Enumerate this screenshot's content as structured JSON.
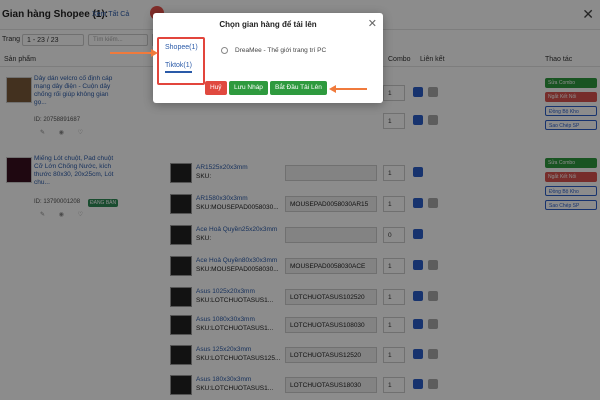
{
  "header": {
    "title": "Gian hàng Shopee (1):",
    "view_all": "Xem Tất Cả",
    "close": "✕"
  },
  "pager": {
    "label": "Trang",
    "range": "1 - 23 / 23",
    "search_placeholder": "Tìm kiếm..."
  },
  "table": {
    "headers": [
      "Sản phẩm",
      "Combo",
      "Liên kết",
      "Thao tác"
    ]
  },
  "products": [
    {
      "name": "Dây dán velcro cố định cáp mạng dây điện - Cuộn dây chống rối giúp không gian gọ...",
      "id": "ID: 20758891687",
      "badge": ""
    },
    {
      "name": "Miếng Lót chuột, Pad chuột Cỡ Lớn Chống Nước, kích thước 80x30, 20x25cm, Lót chu...",
      "id": "ID: 13790001208",
      "badge": "ĐANG BÁN"
    }
  ],
  "variants": [
    {
      "name": "AR1525x20x3mm",
      "sku": "SKU:",
      "sku_value": "",
      "combo": "1"
    },
    {
      "name": "AR1580x30x3mm",
      "sku": "SKU:MOUSEPAD0058030...",
      "sku_value": "MOUSEPAD0058030AR15",
      "combo": "1"
    },
    {
      "name": "Ace Hoả Quyền25x20x3mm",
      "sku": "SKU:",
      "sku_value": "",
      "combo": "0"
    },
    {
      "name": "Ace Hoả Quyền80x30x3mm",
      "sku": "SKU:MOUSEPAD0058030...",
      "sku_value": "MOUSEPAD0058030ACE",
      "combo": "1"
    },
    {
      "name": "Asus 1025x20x3mm",
      "sku": "SKU:LOTCHUOTASUS1...",
      "sku_value": "LOTCHUOTASUS102520",
      "combo": "1"
    },
    {
      "name": "Asus 1080x30x3mm",
      "sku": "SKU:LOTCHUOTASUS1...",
      "sku_value": "LOTCHUOTASUS108030",
      "combo": "1"
    },
    {
      "name": "Asus 125x20x3mm",
      "sku": "SKU:LOTCHUOTASUS125...",
      "sku_value": "LOTCHUOTASUS12520",
      "combo": "1"
    },
    {
      "name": "Asus 180x30x3mm",
      "sku": "SKU:LOTCHUOTASUS1...",
      "sku_value": "LOTCHUOTASUS18030",
      "combo": "1"
    }
  ],
  "actions_row1": [
    "Sửa Combo",
    "Ngắt Kết Nối",
    "Đồng Bộ Kho",
    "Sao Chép SP"
  ],
  "actions_row2": [
    "Sửa Combo",
    "Ngắt Kết Nối",
    "Đồng Bộ Kho",
    "Sao Chép SP"
  ],
  "modal": {
    "title": "Chọn gian hàng để tải lên",
    "tab_shopee": "Shopee(1)",
    "tab_tiktok": "Tiktok(1)",
    "shop_name": "DreaMee - Thế giới trang trí PC",
    "cancel": "Huỷ",
    "save_draft": "Lưu Nháp",
    "start_upload": "Bắt Đầu Tải Lên",
    "close": "✕"
  },
  "colors": {
    "accent": "#2a5aa8",
    "danger": "#e0493f",
    "success": "#2e9a3e",
    "annotation": "#f07a3c"
  }
}
